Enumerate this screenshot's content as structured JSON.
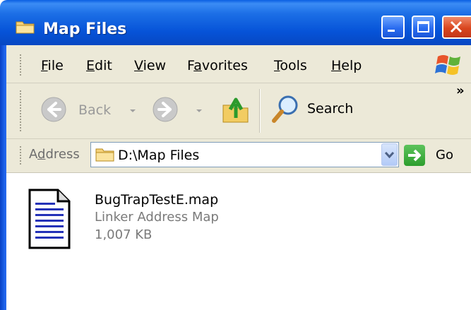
{
  "window": {
    "title": "Map Files"
  },
  "menu": {
    "file": {
      "first": "F",
      "rest": "ile"
    },
    "edit": {
      "first": "E",
      "rest": "dit"
    },
    "view": {
      "first": "V",
      "rest": "iew"
    },
    "favorites": {
      "pre": "F",
      "u": "a",
      "post": "vorites"
    },
    "tools": {
      "first": "T",
      "rest": "ools"
    },
    "help": {
      "first": "H",
      "rest": "elp"
    }
  },
  "toolbar": {
    "back_label": "Back",
    "search_label": "Search",
    "chevron": "»"
  },
  "address": {
    "label_pre": "A",
    "label_u": "d",
    "label_post": "dress",
    "value": "D:\\Map Files",
    "go_label": "Go"
  },
  "files": [
    {
      "name": "BugTrapTestE.map",
      "type": "Linker Address Map",
      "size": "1,007 KB"
    }
  ],
  "colors": {
    "titlebar": "#0653d8",
    "chrome": "#ece9d8",
    "go_green": "#2d9e2d",
    "close_red": "#d9461e"
  }
}
